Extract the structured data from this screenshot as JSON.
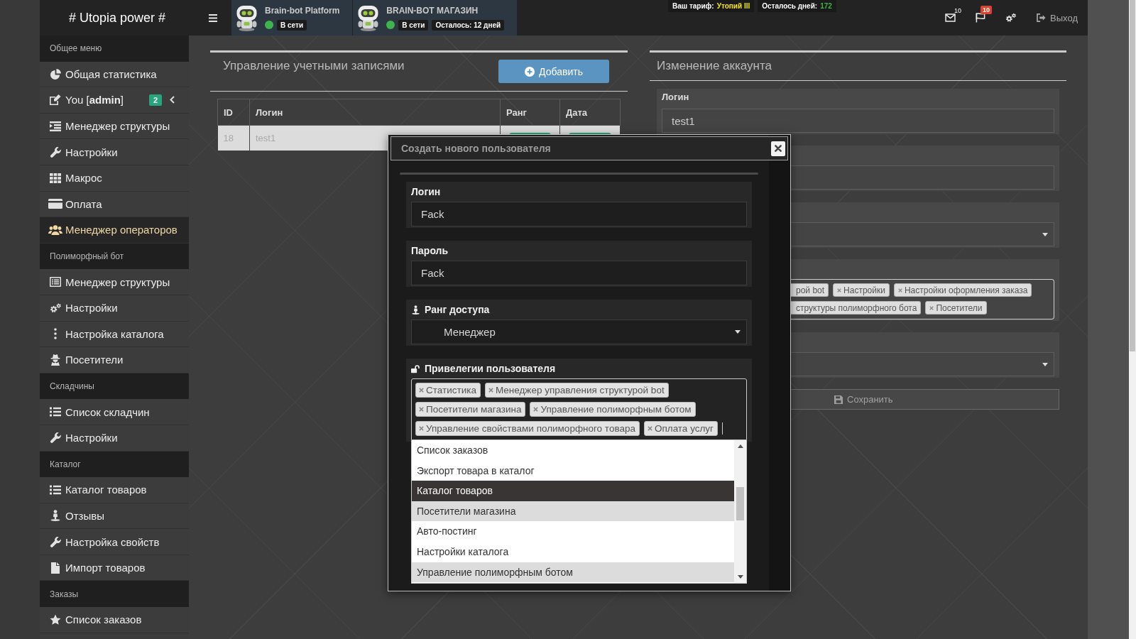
{
  "header": {
    "logo": "# Utopia power #",
    "bots": [
      {
        "name": "Brain-bot Platform",
        "online": true,
        "status": "В сети"
      },
      {
        "name": "BRAIN-BOT МАГАЗИН",
        "online": true,
        "status": "В сети",
        "remaining": "Осталось: 12 дней"
      }
    ],
    "tariff": {
      "label": "Ваш тариф:",
      "value": "Утопий III"
    },
    "days_left": {
      "label": "Осталось дней:",
      "value": "172"
    },
    "notifications": [
      {
        "kind": "mail",
        "count": "10",
        "alert": false
      },
      {
        "kind": "flag",
        "count": "10",
        "alert": true
      }
    ],
    "logout": "Выход"
  },
  "sidebar": {
    "sections": [
      {
        "title": "Общее меню",
        "items": [
          {
            "label": "Общая статистика",
            "selected": false
          },
          {
            "label": "You [**admin**]",
            "selected": false,
            "badge": "2",
            "expanded": false
          },
          {
            "label": "Менеджер структуры",
            "selected": false
          },
          {
            "label": "Настройки",
            "selected": false
          },
          {
            "label": "Макрос",
            "selected": false
          },
          {
            "label": "Оплата",
            "selected": false
          },
          {
            "label": "Менеджер операторов",
            "selected": true
          }
        ]
      },
      {
        "title": "Полиморфный бот",
        "items": [
          {
            "label": "Менеджер структуры",
            "selected": false
          },
          {
            "label": "Настройки",
            "selected": false
          },
          {
            "label": "Настройка каталога",
            "selected": false
          },
          {
            "label": "Посетители",
            "selected": false
          }
        ]
      },
      {
        "title": "Складчины",
        "items": [
          {
            "label": "Список складчин",
            "selected": false
          },
          {
            "label": "Настройки",
            "selected": false
          }
        ]
      },
      {
        "title": "Каталог",
        "items": [
          {
            "label": "Каталог товаров",
            "selected": false
          },
          {
            "label": "Отзывы",
            "selected": false
          },
          {
            "label": "Настройка свойств",
            "selected": false
          },
          {
            "label": "Импорт товаров",
            "selected": false
          }
        ]
      },
      {
        "title": "Заказы",
        "items": [
          {
            "label": "Список заказов",
            "selected": false
          }
        ]
      }
    ]
  },
  "accounts_panel": {
    "title": "Управление учетными записями",
    "add_button": "Добавить",
    "table": {
      "columns": [
        "ID",
        "Логин",
        "Ранг",
        "Дата"
      ],
      "rows": [
        {
          "id": "18",
          "login": "test1"
        }
      ]
    }
  },
  "edit_panel": {
    "title": "Изменение аккаунта",
    "fields": [
      {
        "kind": "input",
        "label": "Логин",
        "value": "test1"
      },
      {
        "kind": "input"
      },
      {
        "kind": "select"
      },
      {
        "kind": "tags",
        "tags": [
          {
            "text": "рой bot",
            "removable": false
          },
          {
            "text": "Настройки",
            "removable": true
          },
          {
            "text": "Настройки оформления заказа",
            "removable": true
          },
          {
            "text": "структуры полиморфного бота",
            "removable": false
          },
          {
            "text": "Посетители",
            "removable": true
          }
        ]
      },
      {
        "kind": "select"
      }
    ],
    "save_button": "Сохранить"
  },
  "modal": {
    "title": "Создать нового пользователя",
    "fields": [
      {
        "kind": "input",
        "label": "Логин",
        "value": "Fack"
      },
      {
        "kind": "input",
        "label": "Пароль",
        "value": "Fack"
      },
      {
        "kind": "select",
        "label": "Ранг доступа",
        "value": "Менеджер"
      },
      {
        "kind": "tags",
        "label": "Привелегии пользователя",
        "tags": [
          {
            "text": "Статистика",
            "removable": true
          },
          {
            "text": "Менеджер управления структурой bot",
            "removable": true
          },
          {
            "text": "Посетители магазина",
            "removable": true
          },
          {
            "text": "Управление полиморфным ботом",
            "removable": true
          },
          {
            "text": "Управление свойствами полиморфного товара",
            "removable": true
          },
          {
            "text": "Оплата услуг",
            "removable": true
          }
        ],
        "options": [
          {
            "label": "Список заказов",
            "selected": false,
            "highlighted": false
          },
          {
            "label": "Экспорт товара в каталог",
            "selected": false,
            "highlighted": false
          },
          {
            "label": "Каталог товаров",
            "selected": false,
            "highlighted": true
          },
          {
            "label": "Посетители магазина",
            "selected": true,
            "highlighted": false
          },
          {
            "label": "Авто-постинг",
            "selected": false,
            "highlighted": false
          },
          {
            "label": "Настройки каталога",
            "selected": false,
            "highlighted": false
          },
          {
            "label": "Управление полиморфным ботом",
            "selected": true,
            "highlighted": false
          }
        ]
      }
    ]
  }
}
